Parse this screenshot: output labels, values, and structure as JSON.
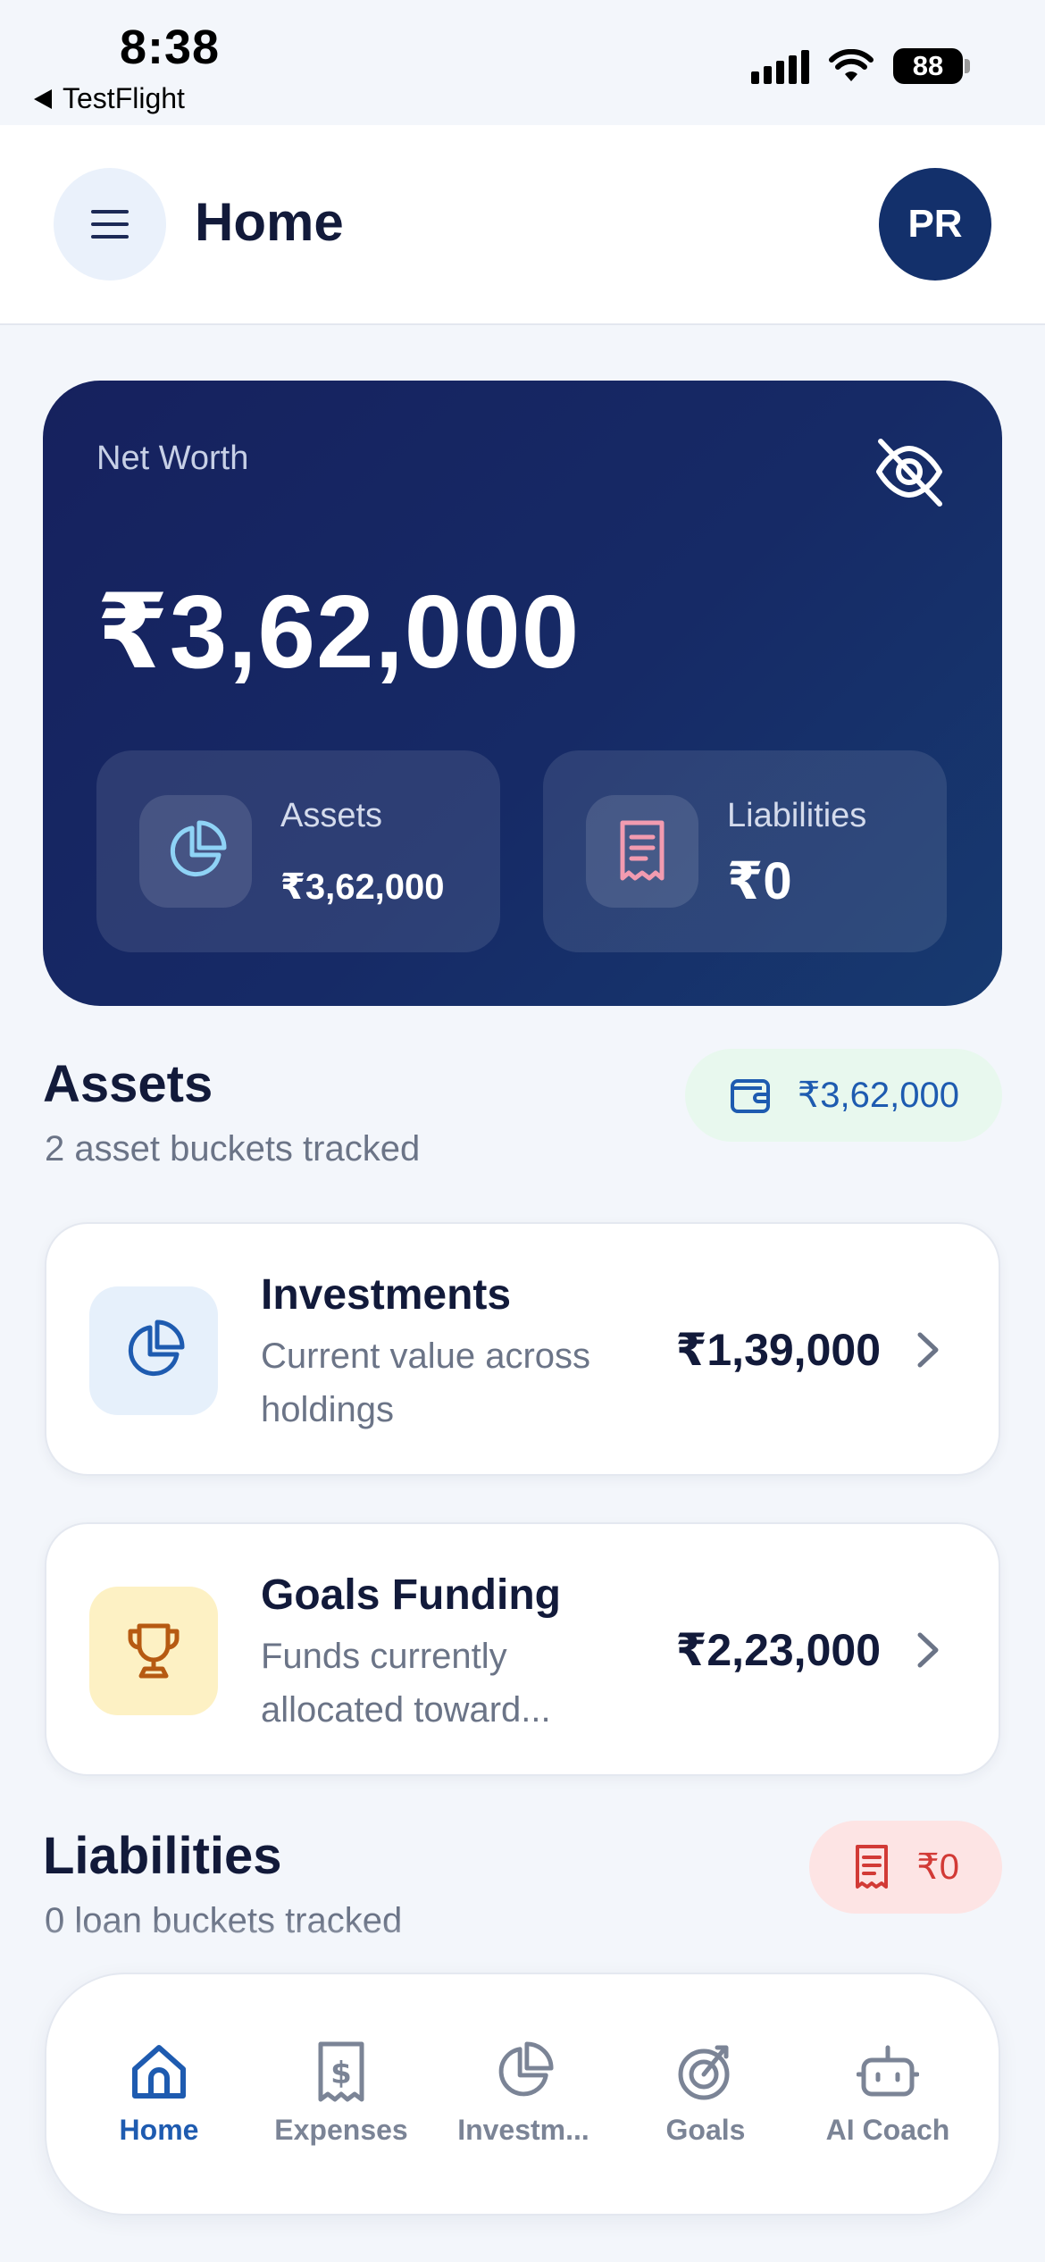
{
  "status_bar": {
    "time": "8:38",
    "back_app": "TestFlight",
    "battery": "88"
  },
  "header": {
    "title": "Home",
    "avatar_initials": "PR"
  },
  "net_worth": {
    "label": "Net Worth",
    "value": "₹3,62,000",
    "assets_label": "Assets",
    "assets_value": "₹3,62,000",
    "liabilities_label": "Liabilities",
    "liabilities_value": "₹0"
  },
  "assets_section": {
    "title": "Assets",
    "subtitle": "2 asset buckets tracked",
    "total": "₹3,62,000",
    "items": [
      {
        "title": "Investments",
        "subtitle": "Current value across holdings",
        "value": "₹1,39,000",
        "icon": "pie-chart-icon"
      },
      {
        "title": "Goals Funding",
        "subtitle": "Funds currently allocated toward...",
        "value": "₹2,23,000",
        "icon": "trophy-icon"
      }
    ]
  },
  "liabilities_section": {
    "title": "Liabilities",
    "subtitle": "0 loan buckets tracked",
    "total": "₹0"
  },
  "bottom_nav": {
    "items": [
      {
        "label": "Home",
        "icon": "home-icon",
        "active": true
      },
      {
        "label": "Expenses",
        "icon": "receipt-icon",
        "active": false
      },
      {
        "label": "Investm...",
        "icon": "pie-chart-icon",
        "active": false
      },
      {
        "label": "Goals",
        "icon": "target-icon",
        "active": false
      },
      {
        "label": "AI Coach",
        "icon": "robot-icon",
        "active": false
      }
    ]
  },
  "colors": {
    "primary": "#1e5bb0",
    "navy": "#16215e",
    "danger": "#d23a36",
    "background": "#f3f6fb"
  }
}
